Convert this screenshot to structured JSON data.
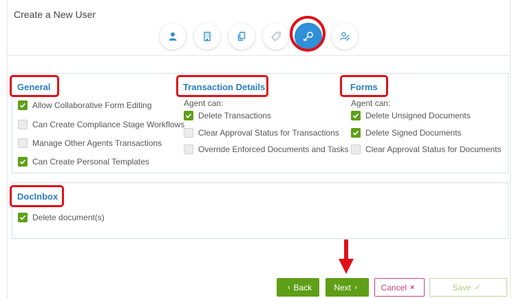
{
  "header": {
    "title": "Create a New User"
  },
  "steps": [
    {
      "icon": "user-icon",
      "active": false
    },
    {
      "icon": "building-icon",
      "active": false
    },
    {
      "icon": "copy-icon",
      "active": false
    },
    {
      "icon": "tag-icon",
      "active": false
    },
    {
      "icon": "key-icon",
      "active": true
    },
    {
      "icon": "user-link-icon",
      "active": false
    }
  ],
  "sections": {
    "general": {
      "title": "General",
      "options": [
        {
          "label": "Allow Collaborative Form Editing",
          "checked": true
        },
        {
          "label": "Can Create Compliance Stage Workflows",
          "checked": false
        },
        {
          "label": "Manage Other Agents Transactions",
          "checked": false
        },
        {
          "label": "Can Create Personal Templates",
          "checked": true
        }
      ]
    },
    "transaction_details": {
      "title": "Transaction Details",
      "subtitle": "Agent can:",
      "options": [
        {
          "label": "Delete Transactions",
          "checked": true
        },
        {
          "label": "Clear Approval Status for Transactions",
          "checked": false
        },
        {
          "label": "Override Enforced Documents and Tasks",
          "checked": false
        }
      ]
    },
    "forms": {
      "title": "Forms",
      "subtitle": "Agent can:",
      "options": [
        {
          "label": "Delete Unsigned Documents",
          "checked": true
        },
        {
          "label": "Delete Signed Documents",
          "checked": true
        },
        {
          "label": "Clear Approval Status for Documents",
          "checked": false
        }
      ]
    },
    "docinbox": {
      "title": "DocInbox",
      "options": [
        {
          "label": "Delete document(s)",
          "checked": true
        }
      ]
    }
  },
  "buttons": {
    "back": "Back",
    "next": "Next",
    "cancel": "Cancel",
    "save": "Save"
  },
  "colors": {
    "accent_blue": "#2a7fc1",
    "active_step": "#2f8fd8",
    "check_green": "#5e9f17",
    "annotation_red": "#e01018",
    "cancel_pink": "#cf3e7b"
  }
}
